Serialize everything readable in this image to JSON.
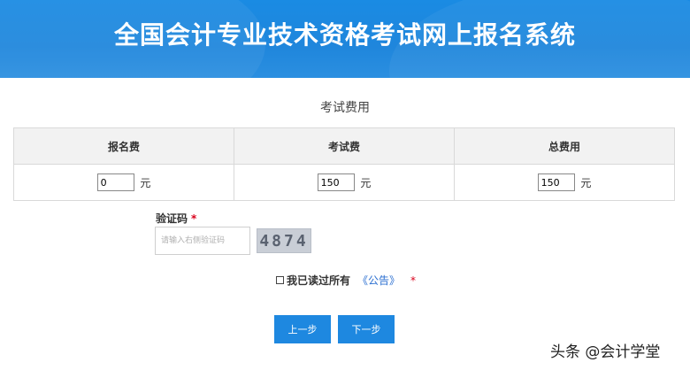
{
  "header": {
    "title": "全国会计专业技术资格考试网上报名系统"
  },
  "section": {
    "title": "考试费用"
  },
  "fees_table": {
    "columns": [
      "报名费",
      "考试费",
      "总费用"
    ],
    "values": [
      "0",
      "150",
      "150"
    ],
    "unit": "元"
  },
  "captcha": {
    "label": "验证码",
    "required_mark": "*",
    "placeholder": "请输入右侧验证码",
    "code": "4874"
  },
  "agreement": {
    "text": "我已读过所有",
    "link_text": "《公告》",
    "required_mark": "*"
  },
  "buttons": {
    "prev": "上一步",
    "next": "下一步"
  },
  "watermark": "头条 @会计学堂"
}
